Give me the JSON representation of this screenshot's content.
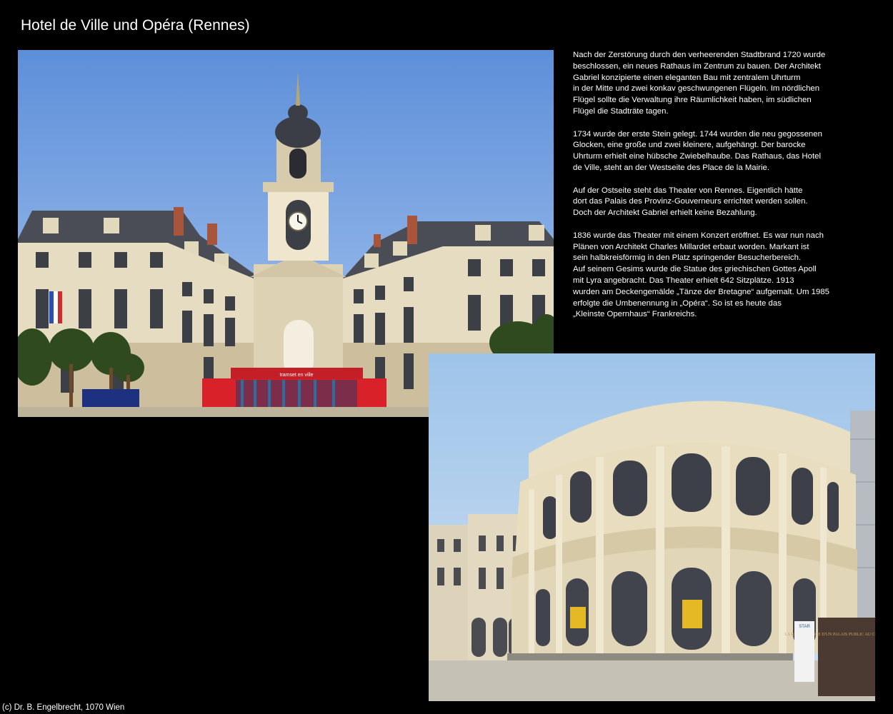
{
  "title": "Hotel de Ville und Opéra (Rennes)",
  "paragraphs": [
    "Nach der Zerstörung durch den verheerenden Stadtbrand 1720 wurde\nbeschlossen, ein neues Rathaus im Zentrum zu bauen. Der Architekt\nGabriel konzipierte einen eleganten Bau mit zentralem Uhrturm\nin der Mitte und zwei konkav geschwungenen Flügeln. Im nördlichen\nFlügel sollte die Verwaltung ihre Räumlichkeit haben, im südlichen\nFlügel die Stadträte tagen.",
    "1734 wurde der erste Stein gelegt. 1744 wurden die neu gegossenen\nGlocken, eine große und zwei kleinere, aufgehängt. Der barocke\nUhrturm erhielt eine hübsche Zwiebelhaube. Das Rathaus, das Hotel\nde Ville, steht an der Westseite des Place de la Mairie.",
    "Auf der Ostseite steht das Theater von Rennes. Eigentlich hätte\ndort das Palais des Provinz-Gouverneurs errichtet werden sollen.\nDoch der Architekt Gabriel erhielt keine Bezahlung.",
    "1836 wurde das Theater mit einem Konzert eröffnet. Es war nun nach\nPlänen von Architekt Charles Millardet erbaut worden. Markant ist\nsein halbkreisförmig in den Platz springender Besucherbereich.\nAuf seinem Gesims wurde die Statue des griechischen Gottes Apoll\nmit Lyra angebracht. Das Theater erhielt 642 Sitzplätze. 1913\nwurden am Deckengemälde „Tänze der Bretagne“ aufgemalt. Um 1985\nerfolgte die Umbenennung in „Opéra“. So ist es heute das\n„Kleinste Opernhaus“ Frankreichs."
  ],
  "photos": {
    "hotel_de_ville": {
      "stage_sign": "tramset en ville"
    },
    "opera": {
      "banner": "LA RENAISSANCE D'UN PALAIS PUBLIC AU CŒUR DE LA CITÉ",
      "sign": "STAR"
    }
  },
  "credit": "(c) Dr. B. Engelbrecht, 1070 Wien",
  "colors": {
    "background": "#000000",
    "text": "#ffffff",
    "sky": "#6f9ee0",
    "stone": "#e6dcc2",
    "roof": "#4a4d55"
  }
}
